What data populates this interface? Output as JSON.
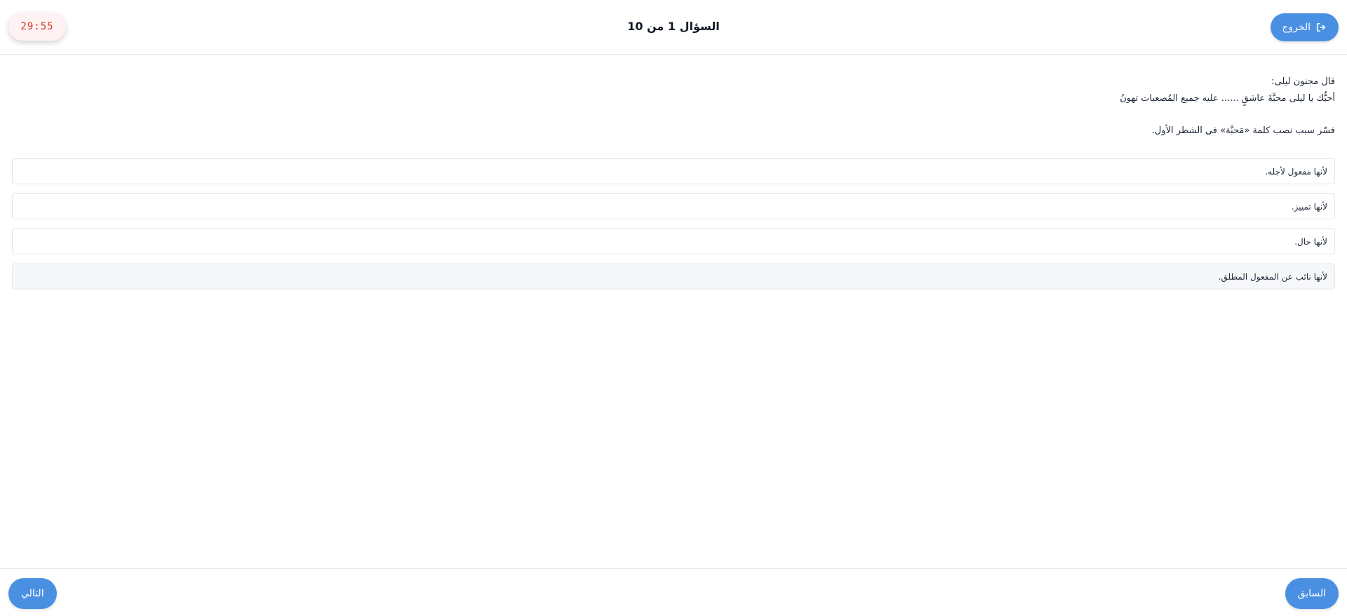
{
  "colors": {
    "accent": "#4a90e2",
    "timer_text": "#d93025",
    "timer_bg": "#fff2f2",
    "border": "#e2e5ea"
  },
  "header": {
    "exit_label": "الخروج",
    "exit_icon": "sign-out-icon",
    "title": "السؤال 1 من 10",
    "timer": "29:55"
  },
  "question": {
    "intro": "قال مجنون ليلى:",
    "verse": "أحبُّك يا ليلى محبَّةَ عاشقٍ ...... عليه جميع المُصعبات تهونُ",
    "prompt": "فسّر سبب نصب كلمة «مَحبَّة» في الشطر الأول."
  },
  "options": [
    "لأنها مفعول لأجله.",
    "لأنها تمييز.",
    "لأنها حال.",
    "لأنها نائب عن المفعول المطلق."
  ],
  "footer": {
    "prev_label": "السابق",
    "next_label": "التالي"
  }
}
